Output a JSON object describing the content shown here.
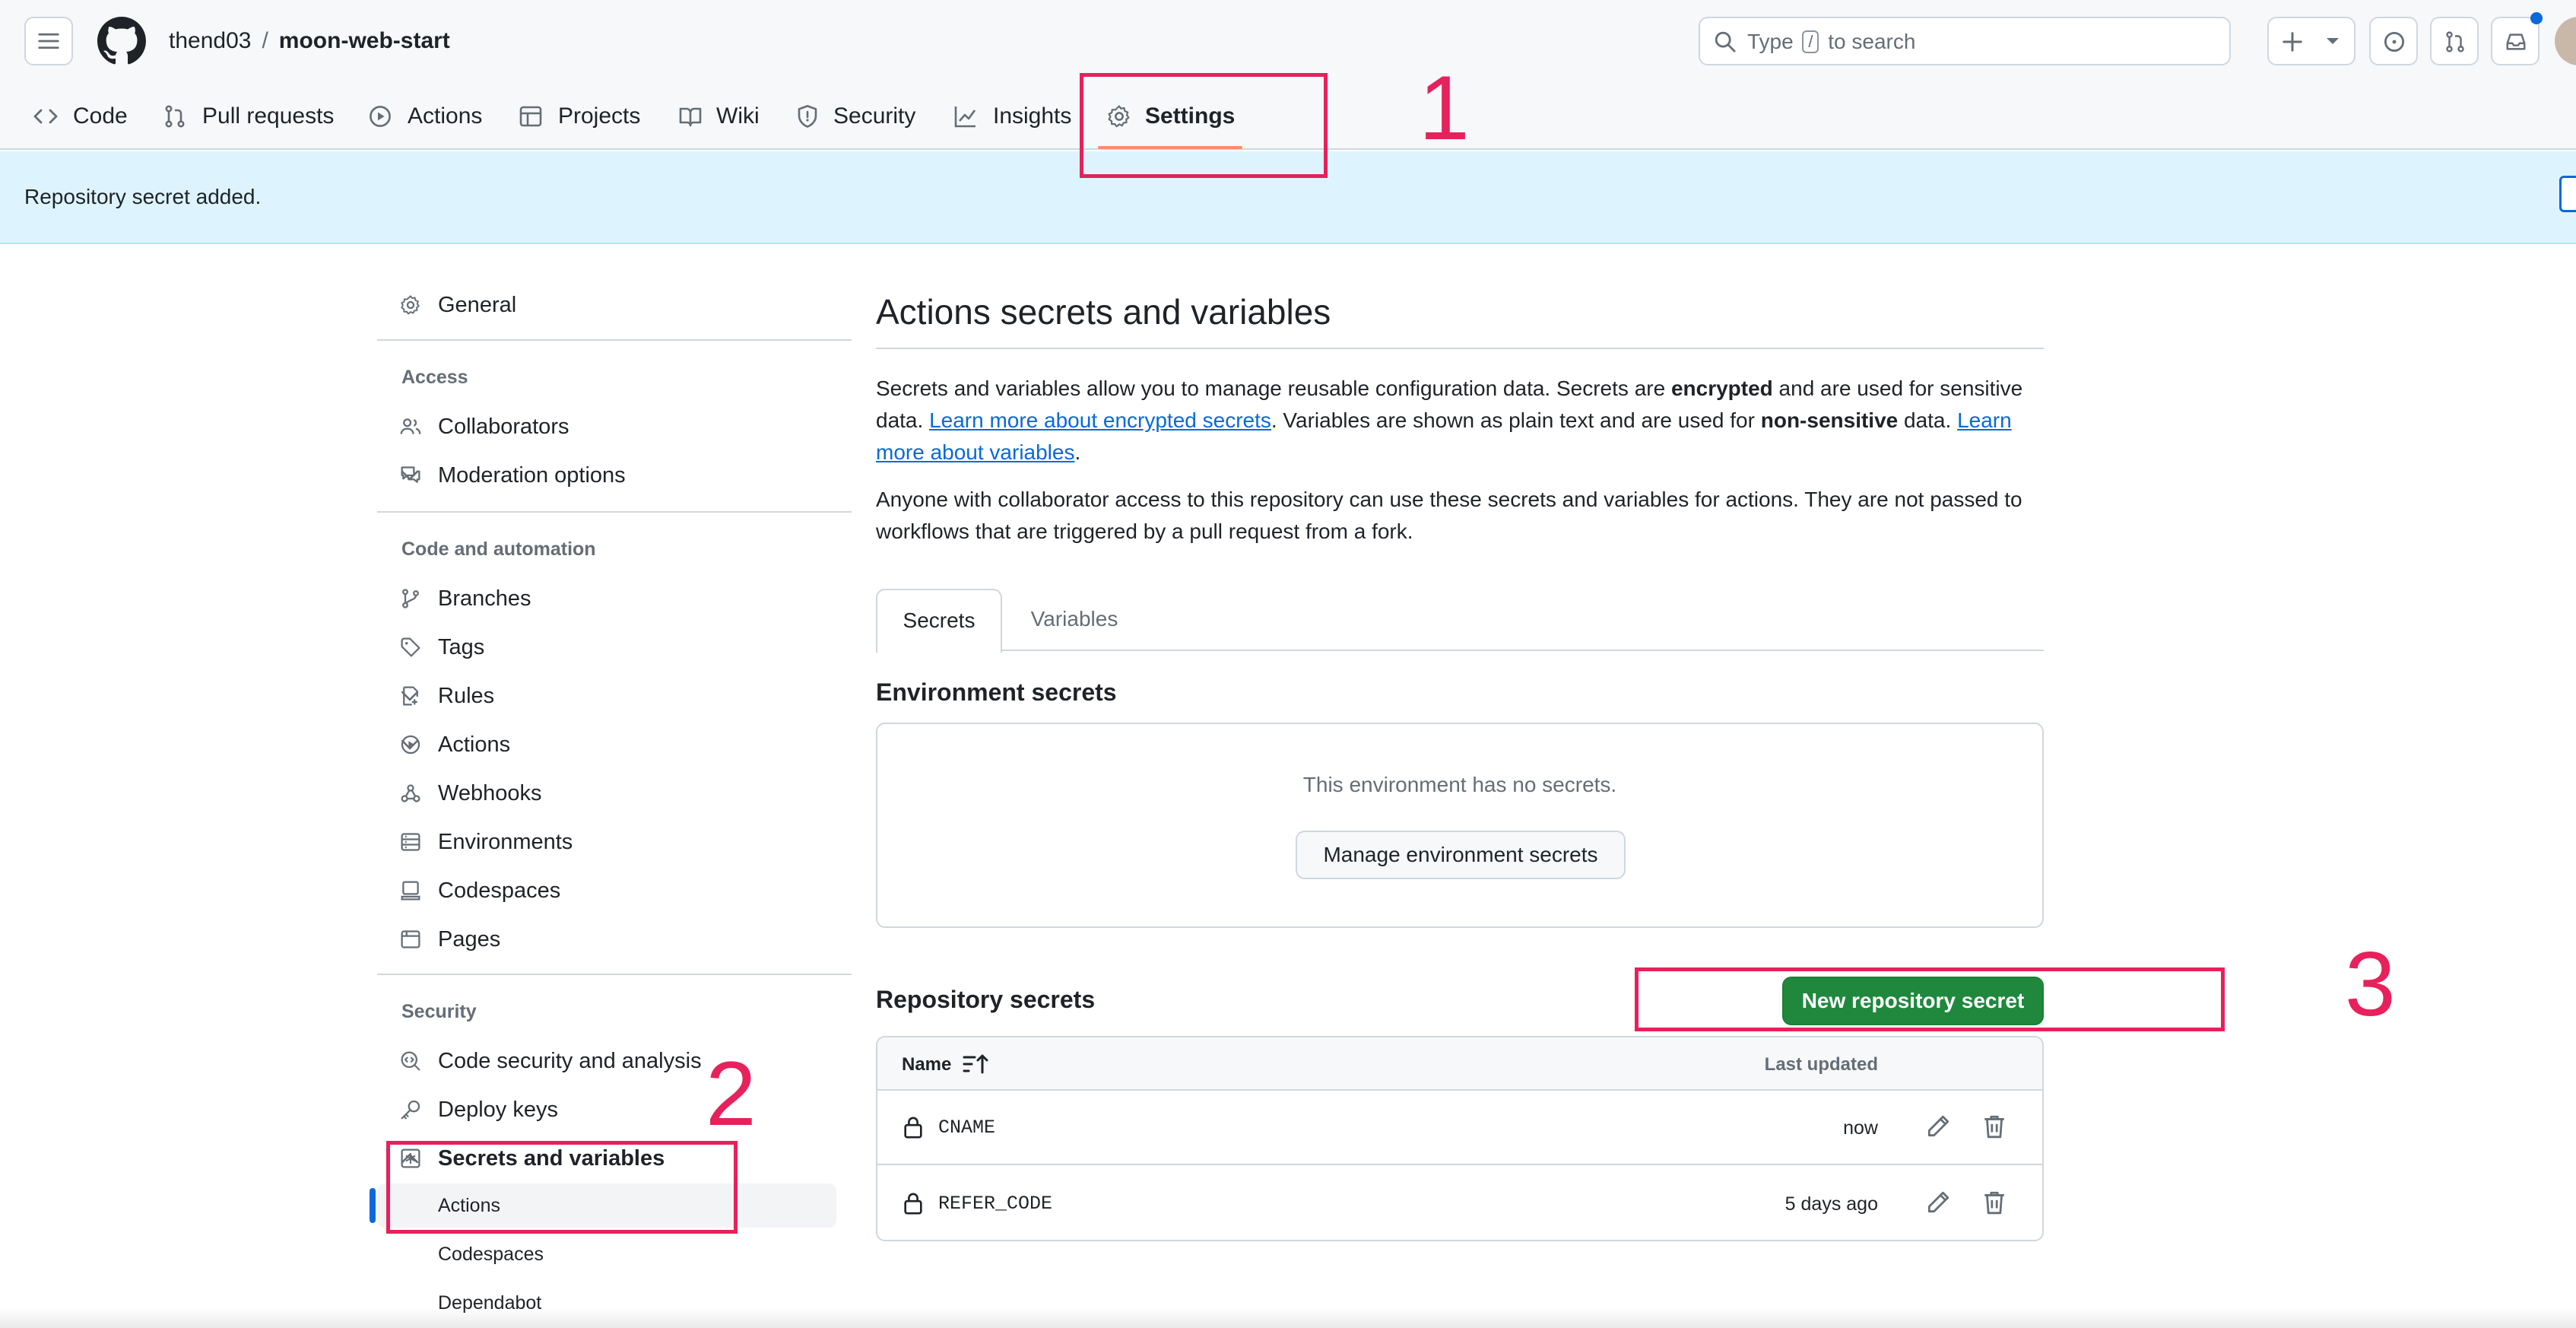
{
  "header": {
    "owner": "thend03",
    "separator": "/",
    "repo": "moon-web-start",
    "search_prefix": "Type",
    "search_key": "/",
    "search_suffix": "to search"
  },
  "nav": {
    "tabs": [
      {
        "label": "Code",
        "icon": "code-icon"
      },
      {
        "label": "Pull requests",
        "icon": "pull-request-icon"
      },
      {
        "label": "Actions",
        "icon": "play-icon"
      },
      {
        "label": "Projects",
        "icon": "table-icon"
      },
      {
        "label": "Wiki",
        "icon": "book-icon"
      },
      {
        "label": "Security",
        "icon": "shield-icon"
      },
      {
        "label": "Insights",
        "icon": "graph-icon"
      },
      {
        "label": "Settings",
        "icon": "gear-icon",
        "selected": true
      }
    ]
  },
  "flash": {
    "message": "Repository secret added."
  },
  "annotations": {
    "one": "1",
    "two": "2",
    "three": "3",
    "color": "#e6215c"
  },
  "sidebar": {
    "general": "General",
    "access_heading": "Access",
    "collaborators": "Collaborators",
    "moderation": "Moderation options",
    "code_heading": "Code and automation",
    "branches": "Branches",
    "tags": "Tags",
    "rules": "Rules",
    "actions": "Actions",
    "webhooks": "Webhooks",
    "environments": "Environments",
    "codespaces": "Codespaces",
    "pages": "Pages",
    "security_heading": "Security",
    "code_security": "Code security and analysis",
    "deploy_keys": "Deploy keys",
    "secrets_vars": "Secrets and variables",
    "sub_actions": "Actions",
    "sub_codespaces": "Codespaces",
    "sub_dependabot": "Dependabot"
  },
  "main": {
    "title": "Actions secrets and variables",
    "intro_1": "Secrets and variables allow you to manage reusable configuration data. Secrets are ",
    "intro_bold_1": "encrypted",
    "intro_2": " and are used for sensitive data. ",
    "intro_link_1": "Learn more about encrypted secrets",
    "intro_3": ". Variables are shown as plain text and are used for ",
    "intro_bold_2": "non-sensitive",
    "intro_4": " data. ",
    "intro_link_2": "Learn more about variables",
    "intro_5": ".",
    "access_note": "Anyone with collaborator access to this repository can use these secrets and variables for actions. They are not passed to workflows that are triggered by a pull request from a fork.",
    "tab_secrets": "Secrets",
    "tab_variables": "Variables",
    "env_title": "Environment secrets",
    "env_empty": "This environment has no secrets.",
    "env_button": "Manage environment secrets",
    "repo_title": "Repository secrets",
    "new_secret_button": "New repository secret",
    "table": {
      "col_name": "Name",
      "col_updated": "Last updated",
      "rows": [
        {
          "name": "CNAME",
          "updated": "now"
        },
        {
          "name": "REFER_CODE",
          "updated": "5 days ago"
        }
      ]
    }
  },
  "colors": {
    "accent_link": "#0969da",
    "primary_button": "#1f883d",
    "flash_bg": "#ddf4ff",
    "tab_underline": "#fd8c73"
  }
}
